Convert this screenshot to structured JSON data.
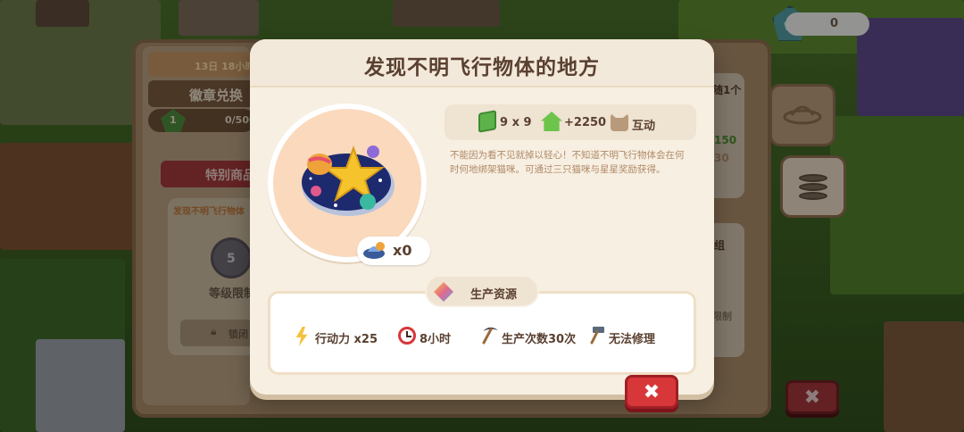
{
  "currency": {
    "icon": "gem-icon",
    "count": "0"
  },
  "background_shop": {
    "timer": "13日 18小时",
    "badge_exchange": "徽章兑换",
    "level": "1",
    "progress": "0/500",
    "special_label": "特别商品",
    "ufo_item": "发现不明飞行物体",
    "lock_level": "5",
    "level_limit": "等级限制",
    "locked": "锁闭",
    "right_top": "随1个",
    "right_value": "150",
    "right_num": "30",
    "right_group": "组",
    "right_limit": "限制"
  },
  "dialog": {
    "title": "发现不明飞行物体的地方",
    "owned_count": "x0",
    "size": "9 x 9",
    "happiness": "+2250",
    "interaction": "互动",
    "description": "不能因为看不见就掉以轻心！不知道不明飞行物体会在何时何地绑架猫咪。可通过三只猫咪与星星奖励获得。",
    "resource_tab": "生产资源",
    "resources": [
      {
        "icon": "lightning-icon",
        "label": "行动力 x25"
      },
      {
        "icon": "alarm-clock-icon",
        "label": "8小时"
      },
      {
        "icon": "pickaxe-icon",
        "label": "生产次数30次"
      },
      {
        "icon": "hammer-icon",
        "label": "无法修理"
      }
    ],
    "close": "✖"
  },
  "colors": {
    "dialog_bg": "#f7efe2",
    "title": "#5a4030",
    "close_red": "#d8373a",
    "accent_green": "#6cc44a"
  }
}
